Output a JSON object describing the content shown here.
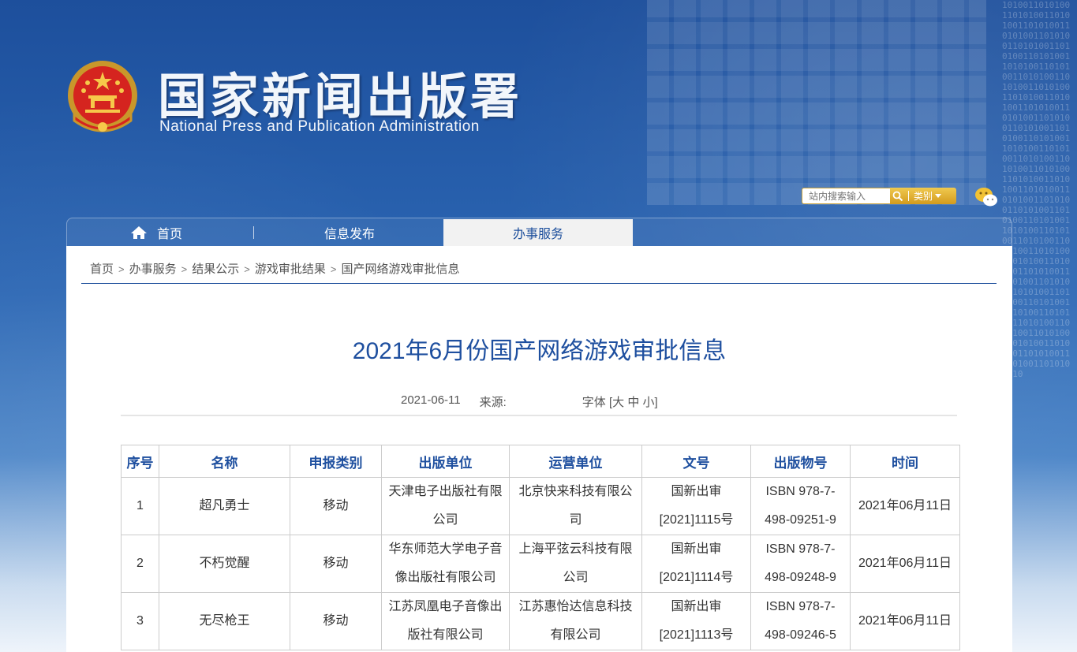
{
  "header": {
    "title": "国家新闻出版署",
    "subtitle": "National  Press and Publication Administration"
  },
  "search": {
    "placeholder": "站内搜索输入",
    "category_label": "类别"
  },
  "nav": {
    "home": "首页",
    "info": "信息发布",
    "service": "办事服务"
  },
  "breadcrumb": [
    "首页",
    "办事服务",
    "结果公示",
    "游戏审批结果",
    "国产网络游戏审批信息"
  ],
  "article": {
    "title": "2021年6月份国产网络游戏审批信息",
    "date": "2021-06-11",
    "source_label": "来源:",
    "font_label": "字体 [",
    "font_large": "大",
    "font_medium": "中",
    "font_small": "小",
    "font_close": "]"
  },
  "table": {
    "headers": [
      "序号",
      "名称",
      "申报类别",
      "出版单位",
      "运营单位",
      "文号",
      "出版物号",
      "时间"
    ],
    "rows": [
      [
        "1",
        "超凡勇士",
        "移动",
        "天津电子出版社有限公司",
        "北京快来科技有限公司",
        "国新出审[2021]1115号",
        "ISBN 978-7-498-09251-9",
        "2021年06月11日"
      ],
      [
        "2",
        "不朽觉醒",
        "移动",
        "华东师范大学电子音像出版社有限公司",
        "上海平弦云科技有限公司",
        "国新出审[2021]1114号",
        "ISBN 978-7-498-09248-9",
        "2021年06月11日"
      ],
      [
        "3",
        "无尽枪王",
        "移动",
        "江苏凤凰电子音像出版社有限公司",
        "江苏惠怡达信息科技有限公司",
        "国新出审[2021]1113号",
        "ISBN 978-7-498-09246-5",
        "2021年06月11日"
      ]
    ]
  },
  "colors": {
    "brand_blue": "#1e4f9f",
    "gold": "#d39b1e"
  }
}
